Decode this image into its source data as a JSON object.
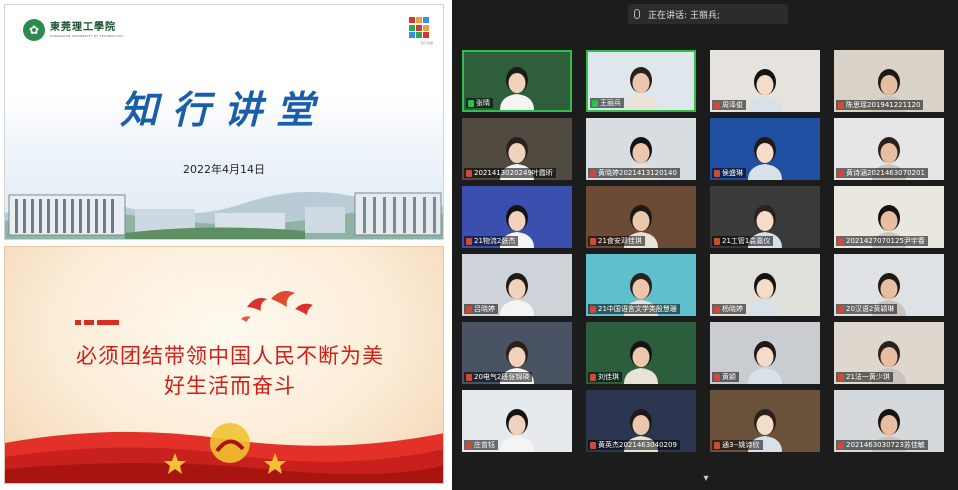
{
  "slide_top": {
    "school_name_cn": "東莞理工學院",
    "school_name_en": "DONGGUAN UNIVERSITY OF TECHNOLOGY",
    "badge_caption": "知行讲堂",
    "title": "知行讲堂",
    "date": "2022年4月14日",
    "colors": {
      "title": "#1b5ea8"
    }
  },
  "slide_bottom": {
    "slogan_line1": "必须团结带领中国人民不断为美",
    "slogan_line2": "好生活而奋斗",
    "colors": {
      "slogan": "#d0201a"
    }
  },
  "meeting": {
    "speaker_label": "正在讲话: 王丽兵;",
    "active_tile_color": "#2fbf4a",
    "expand_icon": "chevron-down-icon",
    "tiles": [
      {
        "name": "张晴",
        "bg": "#2f5e3a",
        "active": true
      },
      {
        "name": "王丽兵",
        "bg": "#dfe6ec",
        "active": true
      },
      {
        "name": "周泽俊",
        "bg": "#e6e3de",
        "active": false
      },
      {
        "name": "陈思瑶201941221120",
        "bg": "#d9d2c6",
        "active": false
      },
      {
        "name": "2021413020249叶霞昕",
        "bg": "#514a40",
        "active": false
      },
      {
        "name": "黄晓婷2021413120140",
        "bg": "#d8dde2",
        "active": false
      },
      {
        "name": "侯盛琳",
        "bg": "#1f4fa0",
        "active": false
      },
      {
        "name": "黄诗涵2021463070201",
        "bg": "#e4e6e8",
        "active": false
      },
      {
        "name": "21物流2张杰",
        "bg": "#3b4fae",
        "active": false
      },
      {
        "name": "21食安邓佳琪",
        "bg": "#6b4b35",
        "active": false
      },
      {
        "name": "21工管1袁嘉仪",
        "bg": "#3a3a3a",
        "active": false
      },
      {
        "name": "2021427070125尹宇春",
        "bg": "#eae6e0",
        "active": false
      },
      {
        "name": "吕晓婷",
        "bg": "#cdd3d8",
        "active": false
      },
      {
        "name": "21中国语言文学类殷慧珊",
        "bg": "#5ec0cc",
        "active": false
      },
      {
        "name": "杨晓婷",
        "bg": "#e2e0dc",
        "active": false
      },
      {
        "name": "20汉语2黄颖琳",
        "bg": "#dfe2e5",
        "active": false
      },
      {
        "name": "20电气2班张锦瑛",
        "bg": "#4a5363",
        "active": false
      },
      {
        "name": "刘佳琪",
        "bg": "#2c5e3e",
        "active": false
      },
      {
        "name": "黄颖",
        "bg": "#c9cdd2",
        "active": false
      },
      {
        "name": "21法一黄少琪",
        "bg": "#ddd7cd",
        "active": false
      },
      {
        "name": "庄曾钰",
        "bg": "#e6eaee",
        "active": false
      },
      {
        "name": "黄英杰2021463040209",
        "bg": "#2c3550",
        "active": false
      },
      {
        "name": "通3--姚诗欣",
        "bg": "#6a513c",
        "active": false
      },
      {
        "name": "2021463030723苏佳敏",
        "bg": "#d6d9dc",
        "active": false
      }
    ]
  }
}
